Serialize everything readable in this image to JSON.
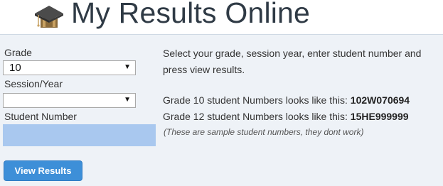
{
  "header": {
    "title": "My Results Online",
    "icon": "graduation-cap-icon"
  },
  "form": {
    "grade": {
      "label": "Grade",
      "value": "10"
    },
    "session": {
      "label": "Session/Year",
      "value": ""
    },
    "student_number": {
      "label": "Student Number",
      "value": ""
    },
    "submit_label": "View Results"
  },
  "info": {
    "instructions_line1": "Select your grade, session year, enter student number and",
    "instructions_line2": "press view results.",
    "grade10_prefix": "Grade 10 student Numbers looks like this:",
    "grade10_sample": "102W070694",
    "grade12_prefix": "Grade 12 student Numbers looks like this:",
    "grade12_sample": "15HE999999",
    "disclaimer": "(These are sample student numbers, they dont work)"
  },
  "colors": {
    "title": "#2f3a45",
    "panel_bg": "#eef2f7",
    "input_fill": "#a9c8ef",
    "button": "#3d8fd8"
  }
}
